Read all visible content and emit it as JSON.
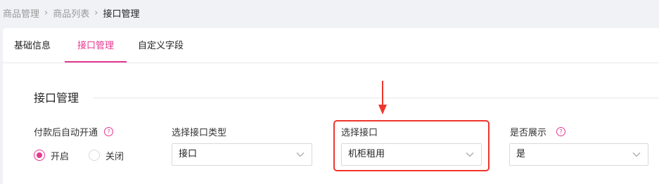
{
  "breadcrumb": {
    "items": [
      "商品管理",
      "商品列表"
    ],
    "current": "接口管理",
    "separator": "›"
  },
  "tabs": [
    {
      "label": "基础信息",
      "active": false
    },
    {
      "label": "接口管理",
      "active": true
    },
    {
      "label": "自定义字段",
      "active": false
    }
  ],
  "section": {
    "title": "接口管理"
  },
  "fields": {
    "auto_open": {
      "label": "付款后自动开通",
      "help_icon": "question-circle-icon",
      "options": [
        {
          "label": "开启",
          "checked": true
        },
        {
          "label": "关闭",
          "checked": false
        }
      ]
    },
    "interface_type": {
      "label": "选择接口类型",
      "value": "接口"
    },
    "interface": {
      "label": "选择接口",
      "value": "机柜租用"
    },
    "display": {
      "label": "是否展示",
      "help_icon": "question-circle-icon",
      "value": "是"
    }
  },
  "colors": {
    "accent": "#e6368f",
    "highlight": "#f0352c",
    "background": "#f0f2f5"
  }
}
